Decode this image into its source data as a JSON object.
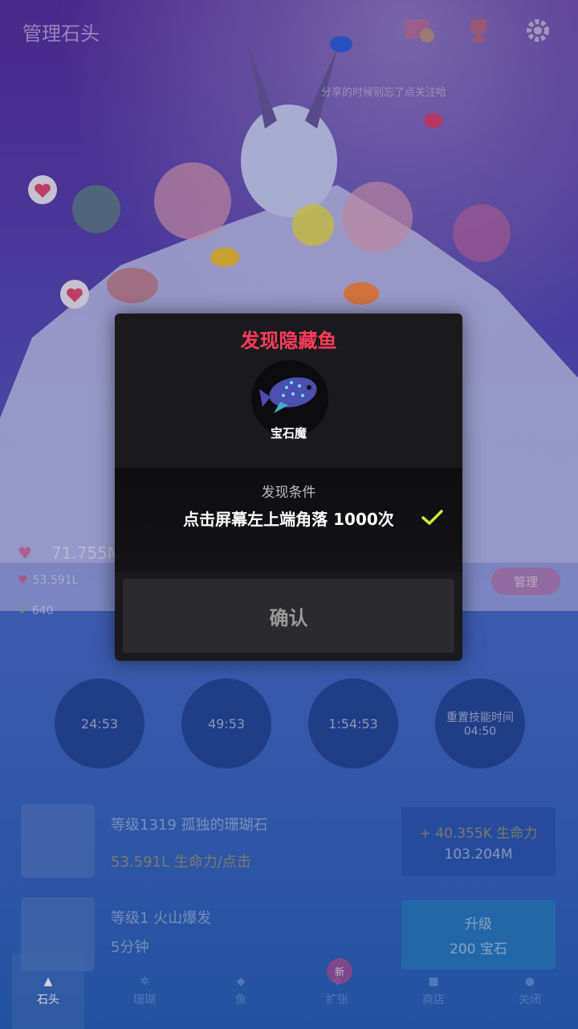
{
  "header": {
    "title": "管理石头",
    "share_hint": "分享的时候别忘了点关注哈"
  },
  "stats": {
    "life_total": "71.755M",
    "tap_rate": "53.591L",
    "gems": "640",
    "manage_label": "管理"
  },
  "timers": [
    {
      "label": "24:53"
    },
    {
      "label": "49:53"
    },
    {
      "label": "1:54:53"
    },
    {
      "label": "重置技能时间",
      "sub": "04:50"
    }
  ],
  "upgrades": [
    {
      "title": "等级1319 孤独的珊瑚石",
      "sub": "53.591L 生命力/点击",
      "box_line1": "+ 40.355K 生命力",
      "box_line2": "103.204M"
    },
    {
      "title": "等级1 火山爆发",
      "sub": "5分钟",
      "box_line1": "升级",
      "box_line2": "200 宝石"
    }
  ],
  "tabs": [
    {
      "label": "石头"
    },
    {
      "label": "珊瑚"
    },
    {
      "label": "鱼"
    },
    {
      "label": "扩张"
    },
    {
      "label": "商店"
    },
    {
      "label": "关闭"
    }
  ],
  "new_badge": "新",
  "modal": {
    "title": "发现隐藏鱼",
    "fish_name": "宝石魔",
    "condition_label": "发现条件",
    "condition_text": "点击屏幕左上端角落 1000次",
    "confirm_label": "确认"
  },
  "colors": {
    "modal_title": "#ff3d5a",
    "check": "#d6e63a",
    "fish_body": "#4b4fb0"
  }
}
